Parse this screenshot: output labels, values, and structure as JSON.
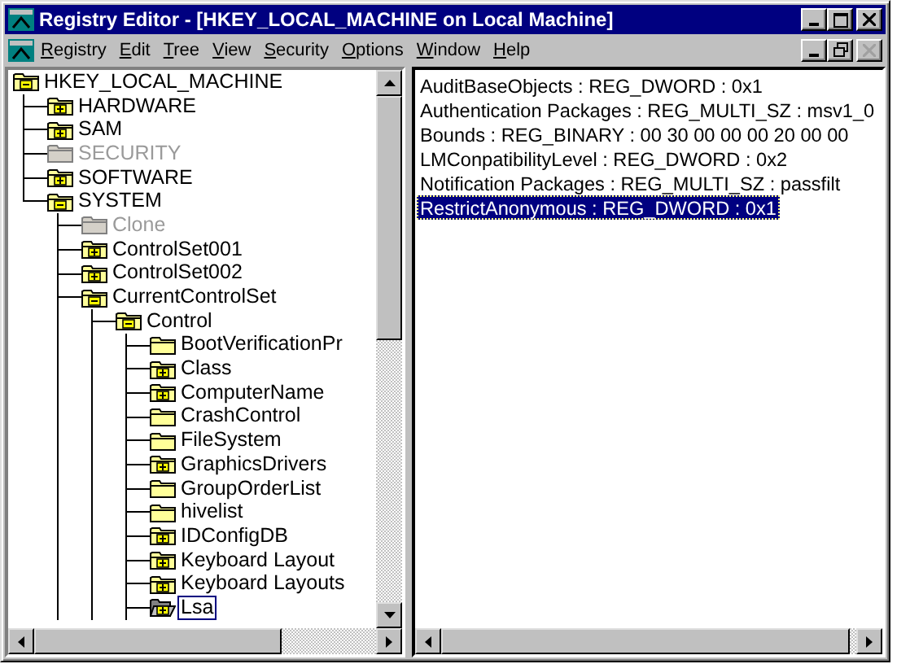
{
  "window": {
    "title": "Registry Editor - [HKEY_LOCAL_MACHINE on Local Machine]"
  },
  "menu": [
    "Registry",
    "Edit",
    "Tree",
    "View",
    "Security",
    "Options",
    "Window",
    "Help"
  ],
  "tree": [
    {
      "label": "HKEY_LOCAL_MACHINE",
      "expandable": true,
      "expanded": true,
      "disabled": false,
      "selected": false,
      "children": [
        {
          "label": "HARDWARE",
          "expandable": true,
          "expanded": false,
          "disabled": false,
          "selected": false
        },
        {
          "label": "SAM",
          "expandable": true,
          "expanded": false,
          "disabled": false,
          "selected": false
        },
        {
          "label": "SECURITY",
          "expandable": false,
          "disabled": true,
          "selected": false
        },
        {
          "label": "SOFTWARE",
          "expandable": true,
          "expanded": false,
          "disabled": false,
          "selected": false
        },
        {
          "label": "SYSTEM",
          "expandable": true,
          "expanded": true,
          "disabled": false,
          "selected": false,
          "children": [
            {
              "label": "Clone",
              "expandable": false,
              "disabled": true,
              "selected": false
            },
            {
              "label": "ControlSet001",
              "expandable": true,
              "expanded": false,
              "disabled": false,
              "selected": false
            },
            {
              "label": "ControlSet002",
              "expandable": true,
              "expanded": false,
              "disabled": false,
              "selected": false
            },
            {
              "label": "CurrentControlSet",
              "expandable": true,
              "expanded": true,
              "disabled": false,
              "selected": false,
              "children": [
                {
                  "label": "Control",
                  "expandable": true,
                  "expanded": true,
                  "disabled": false,
                  "selected": false,
                  "children": [
                    {
                      "label": "BootVerificationPr",
                      "expandable": false,
                      "disabled": false,
                      "selected": false
                    },
                    {
                      "label": "Class",
                      "expandable": true,
                      "expanded": false,
                      "disabled": false,
                      "selected": false
                    },
                    {
                      "label": "ComputerName",
                      "expandable": true,
                      "expanded": false,
                      "disabled": false,
                      "selected": false
                    },
                    {
                      "label": "CrashControl",
                      "expandable": false,
                      "disabled": false,
                      "selected": false
                    },
                    {
                      "label": "FileSystem",
                      "expandable": false,
                      "disabled": false,
                      "selected": false
                    },
                    {
                      "label": "GraphicsDrivers",
                      "expandable": true,
                      "expanded": false,
                      "disabled": false,
                      "selected": false
                    },
                    {
                      "label": "GroupOrderList",
                      "expandable": false,
                      "disabled": false,
                      "selected": false
                    },
                    {
                      "label": "hivelist",
                      "expandable": false,
                      "disabled": false,
                      "selected": false
                    },
                    {
                      "label": "IDConfigDB",
                      "expandable": true,
                      "expanded": false,
                      "disabled": false,
                      "selected": false
                    },
                    {
                      "label": "Keyboard Layout",
                      "expandable": true,
                      "expanded": false,
                      "disabled": false,
                      "selected": false
                    },
                    {
                      "label": "Keyboard Layouts",
                      "expandable": true,
                      "expanded": false,
                      "disabled": false,
                      "selected": false
                    },
                    {
                      "label": "Lsa",
                      "expandable": true,
                      "expanded": false,
                      "disabled": false,
                      "selected": true
                    }
                  ]
                }
              ]
            }
          ]
        }
      ]
    }
  ],
  "values": [
    {
      "text": "AuditBaseObjects : REG_DWORD : 0x1",
      "selected": false
    },
    {
      "text": "Authentication Packages : REG_MULTI_SZ : msv1_0",
      "selected": false
    },
    {
      "text": "Bounds : REG_BINARY : 00 30 00 00 00 20 00 00",
      "selected": false
    },
    {
      "text": "LMConpatibilityLevel : REG_DWORD : 0x2",
      "selected": false
    },
    {
      "text": "Notification Packages : REG_MULTI_SZ : passfilt",
      "selected": false
    },
    {
      "text": "RestrictAnonymous : REG_DWORD : 0x1",
      "selected": true
    }
  ]
}
